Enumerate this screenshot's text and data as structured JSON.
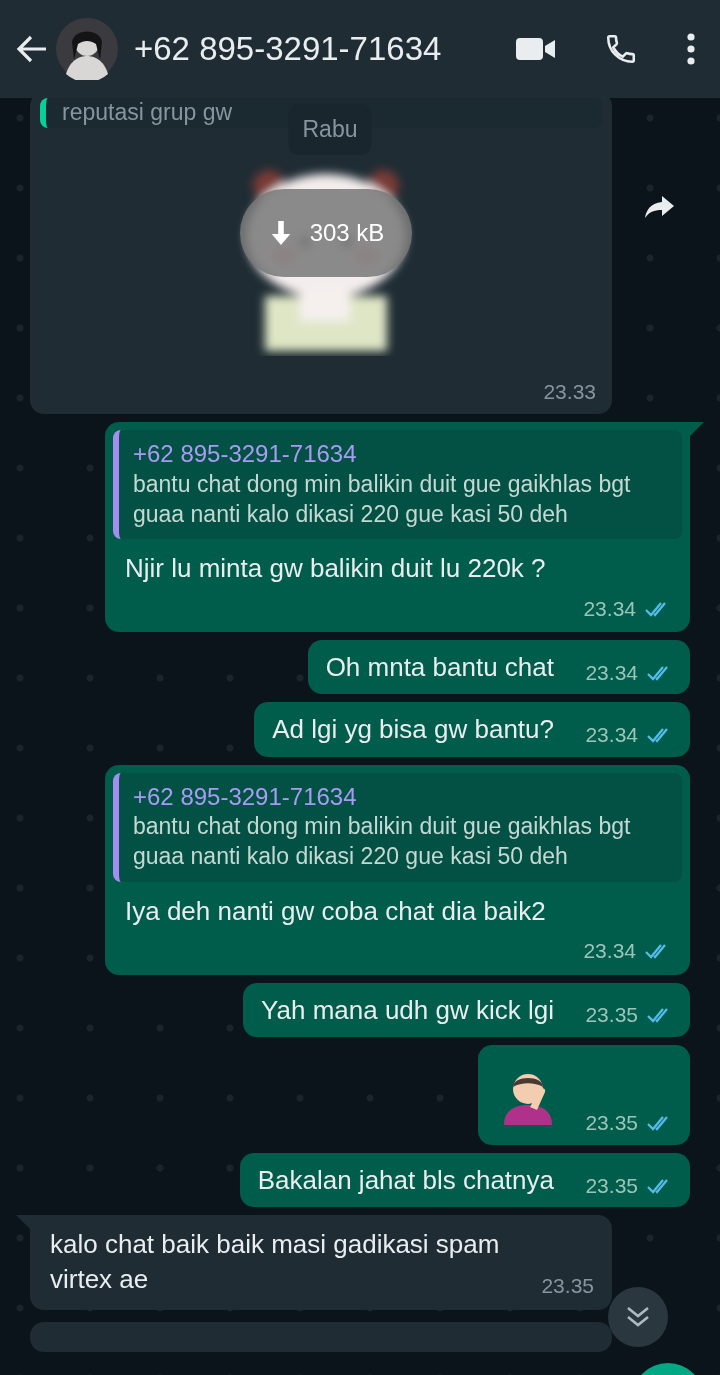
{
  "header": {
    "title": "+62 895-3291-71634"
  },
  "date_chip": "Rabu",
  "messages": [
    {
      "kind": "incoming_sticker",
      "quote_text": "reputasi grup gw",
      "size": "303 kB",
      "time": "23.33"
    },
    {
      "kind": "outgoing",
      "quote": {
        "author": "+62 895-3291-71634",
        "text": "bantu chat dong min balikin duit gue gaikhlas bgt guaa nanti kalo dikasi 220 gue kasi 50 deh"
      },
      "text": "Njir lu minta gw balikin duit lu 220k ?",
      "time": "23.34",
      "read": true,
      "tail": true
    },
    {
      "kind": "outgoing",
      "text": "Oh mnta bantu chat",
      "time": "23.34",
      "read": true,
      "tail": false
    },
    {
      "kind": "outgoing",
      "text": "Ad lgi yg bisa gw bantu?",
      "time": "23.34",
      "read": true,
      "tail": false
    },
    {
      "kind": "outgoing",
      "quote": {
        "author": "+62 895-3291-71634",
        "text": "bantu chat dong min balikin duit gue gaikhlas bgt guaa nanti kalo dikasi 220 gue kasi 50 deh"
      },
      "text": "Iya deh nanti gw coba chat dia baik2",
      "time": "23.34",
      "read": true,
      "tail": false
    },
    {
      "kind": "outgoing",
      "text": "Yah mana udh gw kick lgi",
      "time": "23.35",
      "read": true,
      "tail": false
    },
    {
      "kind": "outgoing_emoji",
      "time": "23.35",
      "read": true,
      "tail": false
    },
    {
      "kind": "outgoing",
      "text": "Bakalan jahat bls chatnya",
      "time": "23.35",
      "read": true,
      "tail": false
    },
    {
      "kind": "incoming",
      "text": "kalo chat baik baik masi gadikasi spam virtex ae",
      "time": "23.35",
      "tail": true
    }
  ]
}
